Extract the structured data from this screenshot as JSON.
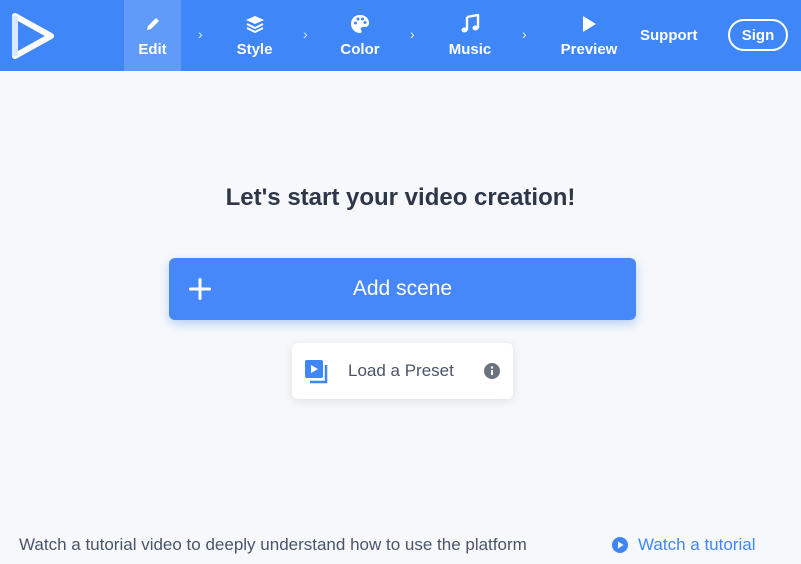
{
  "nav": {
    "steps": [
      {
        "label": "Edit",
        "icon": "pencil-icon",
        "active": true
      },
      {
        "label": "Style",
        "icon": "layers-icon",
        "active": false
      },
      {
        "label": "Color",
        "icon": "palette-icon",
        "active": false
      },
      {
        "label": "Music",
        "icon": "music-note-icon",
        "active": false
      },
      {
        "label": "Preview",
        "icon": "play-icon",
        "active": false
      }
    ],
    "support_label": "Support",
    "sign_label": "Sign"
  },
  "main": {
    "headline": "Let's start your video creation!",
    "add_scene_label": "Add scene",
    "load_preset_label": "Load a Preset"
  },
  "footer": {
    "text": "Watch a tutorial video to deeply understand how to use the platform",
    "tutorial_link": "Watch a tutorial"
  },
  "colors": {
    "brand": "#3f86f9",
    "background": "#f6f8fb",
    "headline": "#2d3748"
  }
}
